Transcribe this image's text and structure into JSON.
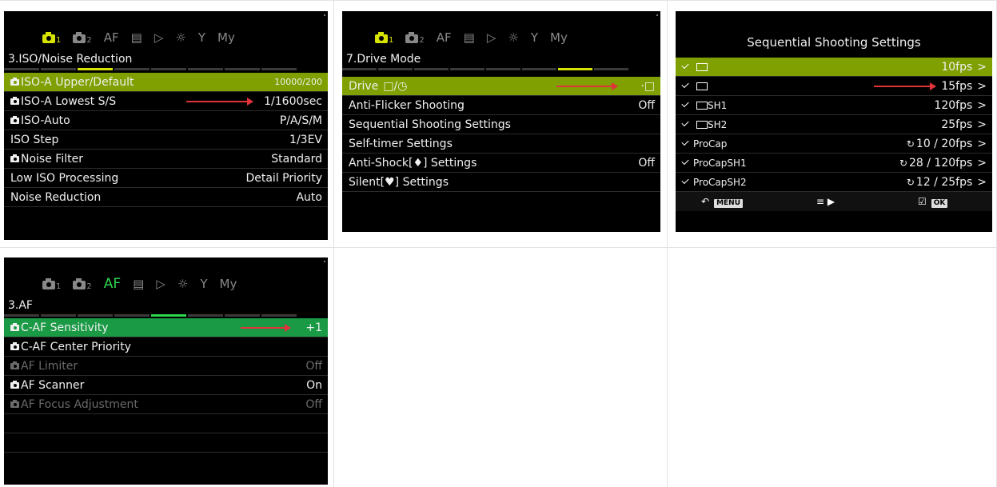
{
  "panels": {
    "iso": {
      "tabs": [
        "1",
        "2",
        "AF",
        "",
        "",
        "",
        "",
        "My"
      ],
      "section_title": "3.ISO/Noise Reduction",
      "rows": [
        {
          "label": "ISO-A Upper/Default",
          "value": "10000/200"
        },
        {
          "label": "ISO-A Lowest S/S",
          "value": "1/1600sec"
        },
        {
          "label": "ISO-Auto",
          "value": "P/A/S/M"
        },
        {
          "label": "ISO Step",
          "value": "1/3EV"
        },
        {
          "label": "Noise Filter",
          "value": "Standard"
        },
        {
          "label": "Low ISO Processing",
          "value": "Detail Priority"
        },
        {
          "label": "Noise Reduction",
          "value": "Auto"
        }
      ]
    },
    "drive": {
      "tabs": [
        "1",
        "2",
        "AF",
        "",
        "",
        "",
        "",
        "My"
      ],
      "section_title": "7.Drive Mode",
      "rows": [
        {
          "label": "Drive",
          "value": ""
        },
        {
          "label": "Anti-Flicker Shooting",
          "value": "Off"
        },
        {
          "label": "Sequential Shooting Settings",
          "value": ""
        },
        {
          "label": "Self-timer Settings",
          "value": ""
        },
        {
          "label": "Anti-Shock[♦] Settings",
          "value": "Off"
        },
        {
          "label": "Silent[♥] Settings",
          "value": ""
        }
      ]
    },
    "seq": {
      "title": "Sequential Shooting Settings",
      "rows": [
        {
          "label": "",
          "value": "10fps"
        },
        {
          "label": "",
          "value": "15fps"
        },
        {
          "label": "SH1",
          "value": "120fps"
        },
        {
          "label": "SH2",
          "value": "25fps"
        },
        {
          "label": "ProCap",
          "value": "10 / 20fps"
        },
        {
          "label": "ProCapSH1",
          "value": "28 / 120fps"
        },
        {
          "label": "ProCapSH2",
          "value": "12 / 25fps"
        }
      ],
      "footer": {
        "back_key": "MENU",
        "ok_key": "OK"
      }
    },
    "af": {
      "tabs": [
        "1",
        "2",
        "AF",
        "",
        "",
        "",
        "",
        "My"
      ],
      "section_title": "3.AF",
      "rows": [
        {
          "label": "C-AF Sensitivity",
          "value": "+1"
        },
        {
          "label": "C-AF Center Priority",
          "value": ""
        },
        {
          "label": "AF Limiter",
          "value": "Off"
        },
        {
          "label": "AF Scanner",
          "value": "On"
        },
        {
          "label": "AF Focus Adjustment",
          "value": "Off"
        }
      ]
    }
  },
  "colors": {
    "accent_yellow": "#d7e300",
    "select_yellow": "#7fa000",
    "accent_green": "#2fd64f",
    "select_green": "#1a9a45",
    "arrow_red": "#e0333a"
  }
}
